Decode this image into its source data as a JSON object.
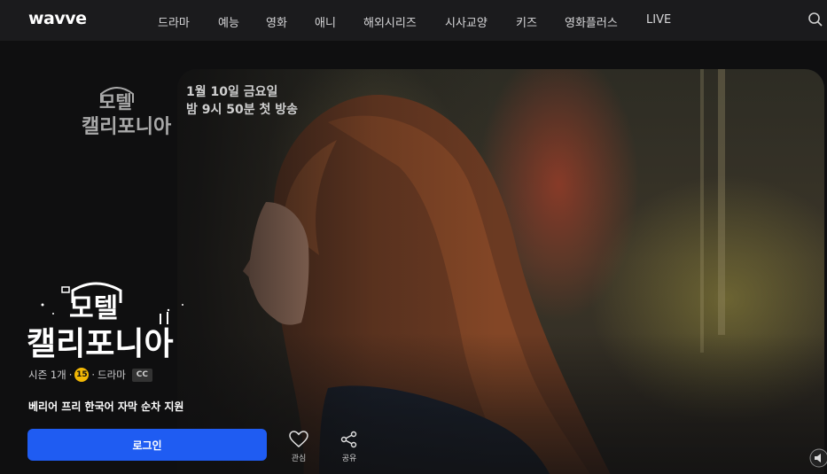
{
  "header": {
    "logo": "wavve",
    "nav": [
      "드라마",
      "예능",
      "영화",
      "애니",
      "해외시리즈",
      "시사교양",
      "키즈",
      "영화플러스",
      "LIVE"
    ],
    "search_icon": "search-icon"
  },
  "hero": {
    "promo_logo_text": "모텔 캘리포니아",
    "promo_line1": "1월 10일 금요일",
    "promo_line2": "밤 9시 50분 첫 방송",
    "title_logo_text": "모텔 캘리포니아",
    "meta": {
      "seasons": "시즌 1개",
      "rating": "15",
      "genre": "드라마",
      "cc": "CC"
    },
    "subtitle": "베리어 프리 한국어 자막 순차 지원",
    "login_label": "로그인",
    "actions": [
      {
        "label": "관심",
        "icon": "heart-icon"
      },
      {
        "label": "공유",
        "icon": "share-icon"
      }
    ]
  },
  "colors": {
    "accent": "#1f5cf2",
    "rating_badge": "#f2b705",
    "header_bg": "#1b1b1d"
  }
}
